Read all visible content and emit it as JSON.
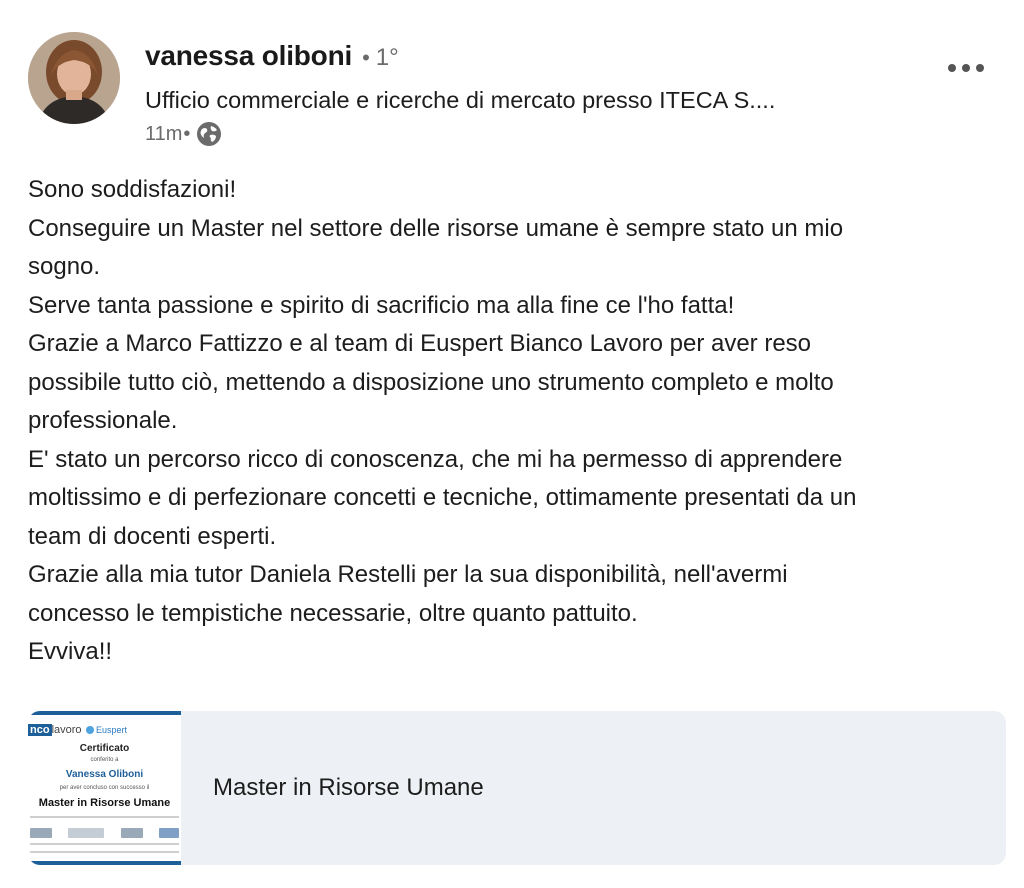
{
  "author": {
    "name": "vanessa oliboni",
    "separator": "•",
    "degree": "1°",
    "headline": "Ufficio commerciale e ricerche di mercato presso ITECA S....",
    "time": "11m",
    "time_separator": "•",
    "visibility_icon": "globe-icon",
    "menu_icon": "more-options-icon"
  },
  "post": {
    "lines": [
      "Sono soddisfazioni!",
      "Conseguire un Master nel settore delle risorse umane è sempre stato un mio",
      "sogno.",
      "Serve tanta passione e spirito di sacrificio ma alla fine ce l'ho fatta!",
      "Grazie a Marco Fattizzo e al team di Euspert Bianco Lavoro per aver reso",
      "possibile tutto ciò, mettendo a disposizione uno strumento completo e molto",
      "professionale.",
      "E' stato un percorso ricco di conoscenza, che mi ha permesso di apprendere",
      "moltissimo e di perfezionare concetti e tecniche, ottimamente presentati da un",
      "team di docenti esperti.",
      "Grazie alla mia tutor Daniela Restelli per la sua disponibilità, nell'avermi",
      "concesso le tempistiche necessarie, oltre quanto pattuito.",
      "Evviva!!"
    ]
  },
  "attachment": {
    "title": "Master in Risorse Umane",
    "thumbnail": {
      "logo_left_box": "nco",
      "logo_left_text": "lavoro",
      "logo_right": "Euspert",
      "certificate": "Certificato",
      "conferred": "conferito a",
      "recipient": "Vanessa Oliboni",
      "completed": "per aver concluso con successo il",
      "course": "Master in Risorse Umane"
    }
  },
  "colors": {
    "card_background": "#edf1f6",
    "brand_blue": "#1d5f99",
    "text": "#1d1d1d",
    "muted": "#6b6b6b"
  }
}
